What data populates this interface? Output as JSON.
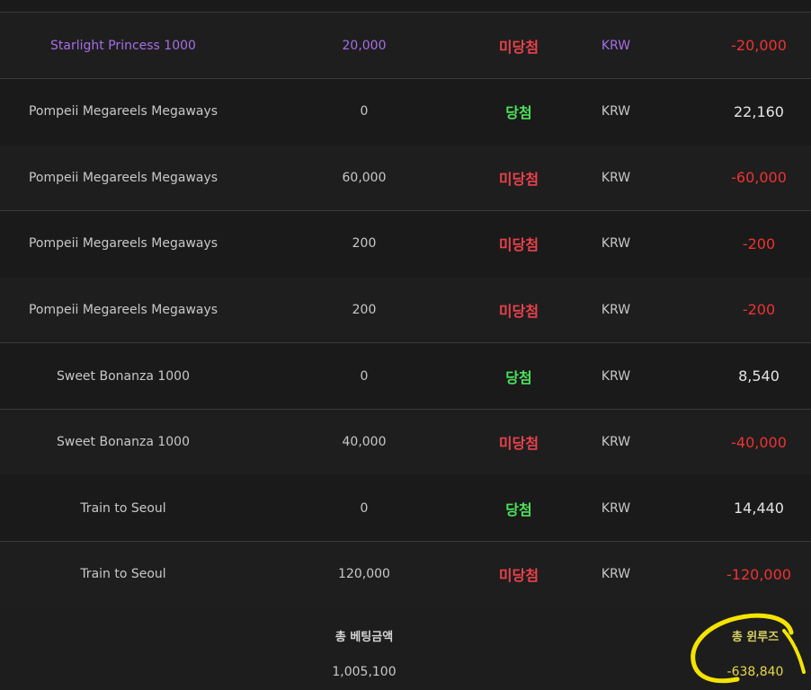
{
  "rows": [
    {
      "game": "Starlight Princess 1000",
      "bet": "20,000",
      "result": "미당첨",
      "currency": "KRW",
      "winloss": "-20,000",
      "highlight": "purple"
    },
    {
      "game": "Pompeii Megareels Megaways",
      "bet": "0",
      "result": "당첨",
      "currency": "KRW",
      "winloss": "22,160"
    },
    {
      "game": "Pompeii Megareels Megaways",
      "bet": "60,000",
      "result": "미당첨",
      "currency": "KRW",
      "winloss": "-60,000"
    },
    {
      "game": "Pompeii Megareels Megaways",
      "bet": "200",
      "result": "미당첨",
      "currency": "KRW",
      "winloss": "-200"
    },
    {
      "game": "Pompeii Megareels Megaways",
      "bet": "200",
      "result": "미당첨",
      "currency": "KRW",
      "winloss": "-200"
    },
    {
      "game": "Sweet Bonanza 1000",
      "bet": "0",
      "result": "당첨",
      "currency": "KRW",
      "winloss": "8,540"
    },
    {
      "game": "Sweet Bonanza 1000",
      "bet": "40,000",
      "result": "미당첨",
      "currency": "KRW",
      "winloss": "-40,000"
    },
    {
      "game": "Train to Seoul",
      "bet": "0",
      "result": "당첨",
      "currency": "KRW",
      "winloss": "14,440"
    },
    {
      "game": "Train to Seoul",
      "bet": "120,000",
      "result": "미당첨",
      "currency": "KRW",
      "winloss": "-120,000"
    }
  ],
  "footer": {
    "total_bet_label": "총 베팅금액",
    "total_bet_value": "1,005,100",
    "total_winloss_label": "총 윈루즈",
    "total_winloss_value": "-638,840"
  },
  "colors": {
    "lose": "#e8414b",
    "win": "#4ce05a",
    "negative_amount": "#ef3232",
    "highlight_row": "#a66ee8",
    "annotation": "#f5e400"
  }
}
